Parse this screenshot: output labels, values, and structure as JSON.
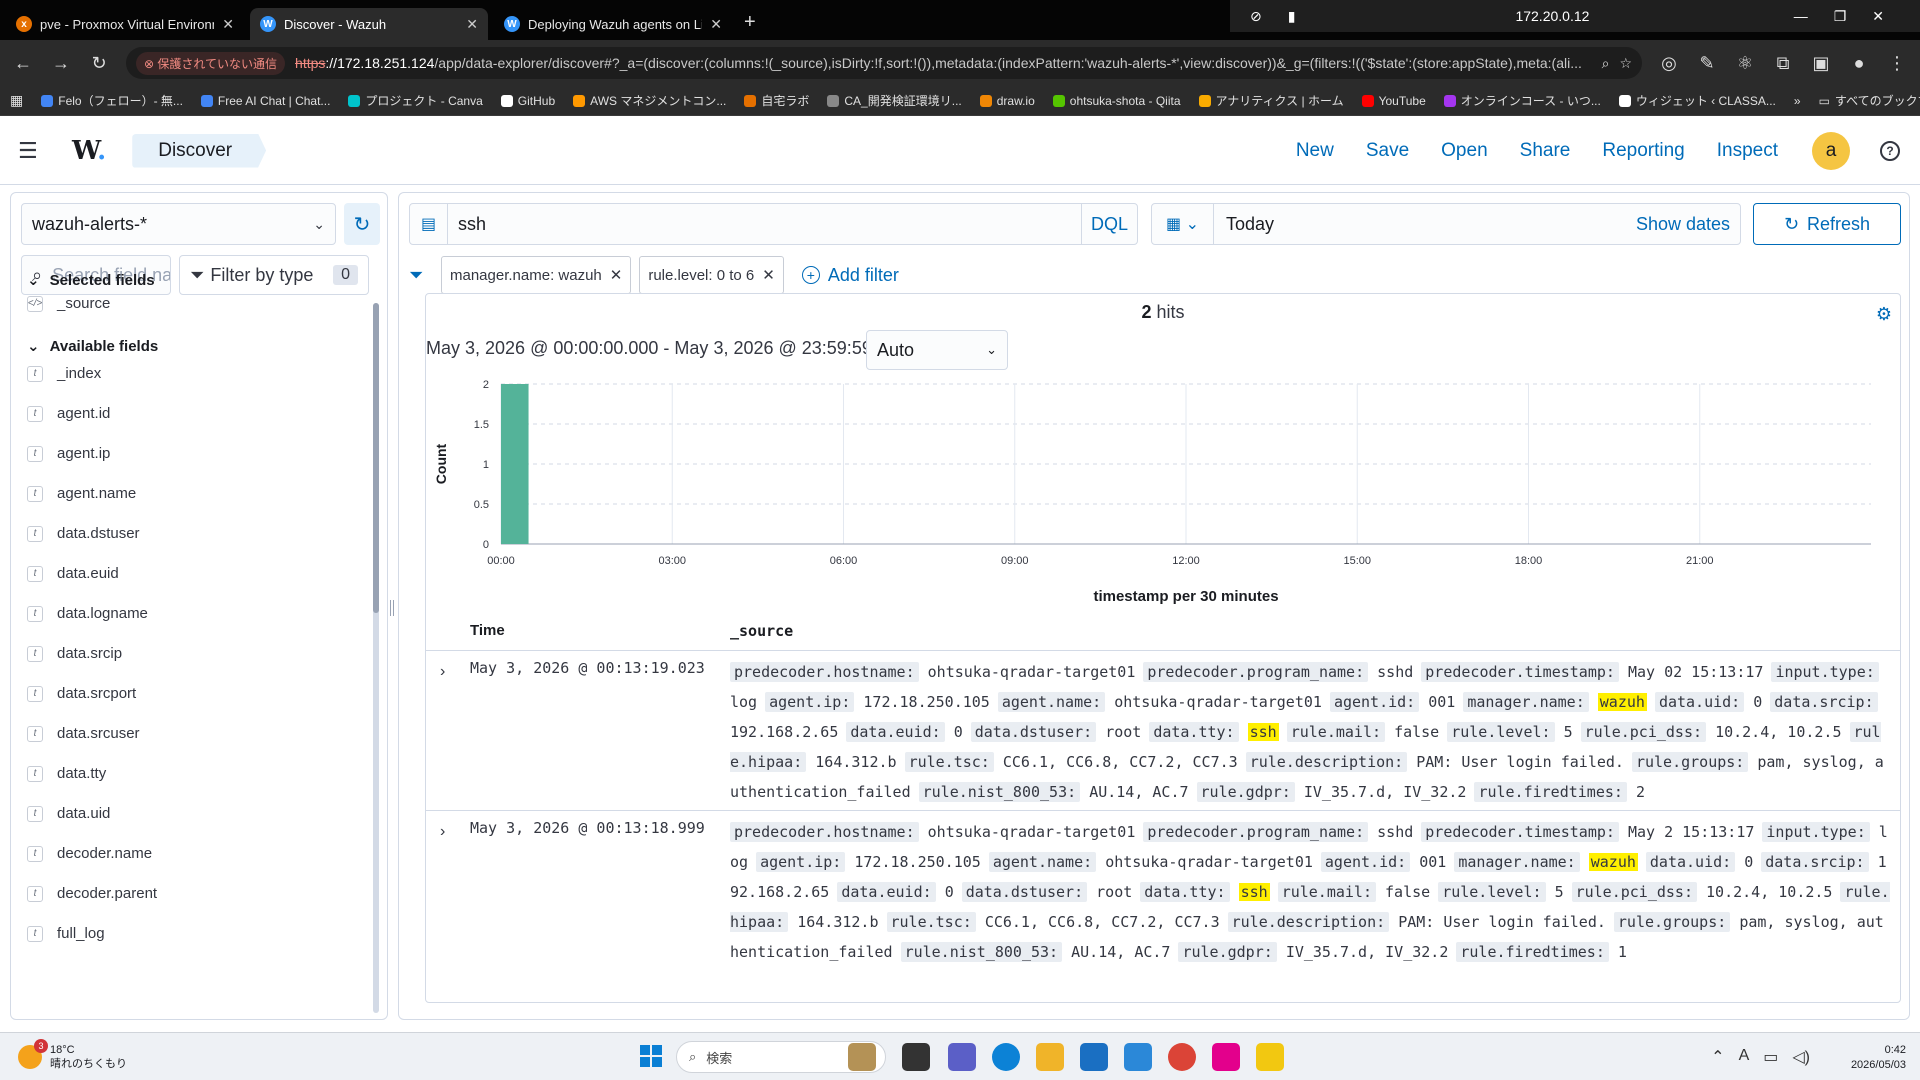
{
  "browser": {
    "tabs": [
      {
        "title": "pve - Proxmox Virtual Environment",
        "favicon_color": "#e57000",
        "favicon": "x",
        "active": false
      },
      {
        "title": "Discover - Wazuh",
        "favicon_color": "#3595f9",
        "favicon": "W",
        "active": true
      },
      {
        "title": "Deploying Wazuh agents on Linux",
        "favicon_color": "#3595f9",
        "favicon": "W",
        "active": false
      }
    ],
    "new_tab": "+",
    "system_ip": "172.20.0.12",
    "insecure_label": "保護されていない通信",
    "url_scheme": "https",
    "url_host": "://172.18.251.124",
    "url_path": "/app/data-explorer/discover#?_a=(discover:(columns:!(_source),isDirty:!f,sort:!()),metadata:(indexPattern:'wazuh-alerts-*',view:discover))&_g=(filters:!(('$state':(store:appState),meta:(ali...",
    "bookmarks": [
      {
        "label": "Felo（フェロー）- 無...",
        "color": "#4285f4"
      },
      {
        "label": "Free AI Chat | Chat...",
        "color": "#4285f4"
      },
      {
        "label": "プロジェクト - Canva",
        "color": "#00c4cc"
      },
      {
        "label": "GitHub",
        "color": "#ffffff"
      },
      {
        "label": "AWS マネジメントコン...",
        "color": "#ff9900"
      },
      {
        "label": "自宅ラボ",
        "color": "#e57000"
      },
      {
        "label": "CA_開発検証環境リ...",
        "color": "#888888"
      },
      {
        "label": "draw.io",
        "color": "#f08705"
      },
      {
        "label": "ohtsuka-shota - Qiita",
        "color": "#55c500"
      },
      {
        "label": "アナリティクス | ホーム",
        "color": "#f9ab00"
      },
      {
        "label": "YouTube",
        "color": "#ff0000"
      },
      {
        "label": "オンラインコース - いつ...",
        "color": "#a435f0"
      },
      {
        "label": "ウィジェット ‹ CLASSA...",
        "color": "#ffffff"
      }
    ],
    "bookmarks_more": "»",
    "all_bookmarks": "すべてのブックマーク"
  },
  "app": {
    "logo_text": "W",
    "logo_dot": ".",
    "breadcrumb": "Discover",
    "nav": [
      "New",
      "Save",
      "Open",
      "Share",
      "Reporting",
      "Inspect"
    ],
    "avatar": "a",
    "help": "?"
  },
  "sidebar": {
    "index_pattern": "wazuh-alerts-*",
    "search_placeholder": "Search field names",
    "filter_by_type": "Filter by type",
    "filter_count": "0",
    "selected_title": "Selected fields",
    "selected_fields": [
      "_source"
    ],
    "available_title": "Available fields",
    "available_fields": [
      "_index",
      "agent.id",
      "agent.ip",
      "agent.name",
      "data.dstuser",
      "data.euid",
      "data.logname",
      "data.srcip",
      "data.srcport",
      "data.srcuser",
      "data.tty",
      "data.uid",
      "decoder.name",
      "decoder.parent",
      "full_log"
    ]
  },
  "query": {
    "value": "ssh",
    "language": "DQL",
    "date_label": "Today",
    "show_dates": "Show dates",
    "refresh": "Refresh",
    "filters": [
      "manager.name: wazuh",
      "rule.level: 0 to 6"
    ],
    "add_filter": "Add filter"
  },
  "results": {
    "hits_count": "2",
    "hits_label": "hits",
    "range": "May 3, 2026 @ 00:00:00.000 - May 3, 2026 @ 23:59:59.999 per",
    "interval": "Auto",
    "col_time": "Time",
    "col_source": "_source",
    "rows": [
      {
        "time": "May 3, 2026 @ 00:13:19.023",
        "fields": [
          [
            "predecoder.hostname:",
            "ohtsuka-qradar-target01"
          ],
          [
            "predecoder.program_name:",
            "sshd"
          ],
          [
            "predecoder.timestamp:",
            "May 02 15:13:17"
          ],
          [
            "input.type:",
            "log"
          ],
          [
            "agent.ip:",
            "172.18.250.105"
          ],
          [
            "agent.name:",
            "ohtsuka-qradar-target01"
          ],
          [
            "agent.id:",
            "001"
          ],
          [
            "manager.name:",
            "wazuh"
          ],
          [
            "data.uid:",
            "0"
          ],
          [
            "data.srcip:",
            "192.168.2.65"
          ],
          [
            "data.euid:",
            "0"
          ],
          [
            "data.dstuser:",
            "root"
          ],
          [
            "data.tty:",
            "ssh"
          ],
          [
            "rule.mail:",
            "false"
          ],
          [
            "rule.level:",
            "5"
          ],
          [
            "rule.pci_dss:",
            "10.2.4, 10.2.5"
          ],
          [
            "rule.hipaa:",
            "164.312.b"
          ],
          [
            "rule.tsc:",
            "CC6.1, CC6.8, CC7.2, CC7.3"
          ],
          [
            "rule.description:",
            "PAM: User login failed."
          ],
          [
            "rule.groups:",
            "pam, syslog, authentication_failed"
          ],
          [
            "rule.nist_800_53:",
            "AU.14, AC.7"
          ],
          [
            "rule.gdpr:",
            "IV_35.7.d, IV_32.2"
          ],
          [
            "rule.firedtimes:",
            "2"
          ]
        ],
        "highlight": [
          "wazuh",
          "ssh"
        ]
      },
      {
        "time": "May 3, 2026 @ 00:13:18.999",
        "fields": [
          [
            "predecoder.hostname:",
            "ohtsuka-qradar-target01"
          ],
          [
            "predecoder.program_name:",
            "sshd"
          ],
          [
            "predecoder.timestamp:",
            "May 2 15:13:17"
          ],
          [
            "input.type:",
            "log"
          ],
          [
            "agent.ip:",
            "172.18.250.105"
          ],
          [
            "agent.name:",
            "ohtsuka-qradar-target01"
          ],
          [
            "agent.id:",
            "001"
          ],
          [
            "manager.name:",
            "wazuh"
          ],
          [
            "data.uid:",
            "0"
          ],
          [
            "data.srcip:",
            "192.168.2.65"
          ],
          [
            "data.euid:",
            "0"
          ],
          [
            "data.dstuser:",
            "root"
          ],
          [
            "data.tty:",
            "ssh"
          ],
          [
            "rule.mail:",
            "false"
          ],
          [
            "rule.level:",
            "5"
          ],
          [
            "rule.pci_dss:",
            "10.2.4, 10.2.5"
          ],
          [
            "rule.hipaa:",
            "164.312.b"
          ],
          [
            "rule.tsc:",
            "CC6.1, CC6.8, CC7.2, CC7.3"
          ],
          [
            "rule.description:",
            "PAM: User login failed."
          ],
          [
            "rule.groups:",
            "pam, syslog, authentication_failed"
          ],
          [
            "rule.nist_800_53:",
            "AU.14, AC.7"
          ],
          [
            "rule.gdpr:",
            "IV_35.7.d, IV_32.2"
          ],
          [
            "rule.firedtimes:",
            "1"
          ]
        ],
        "highlight": [
          "wazuh",
          "ssh"
        ]
      }
    ]
  },
  "histogram": {
    "ylabel": "Count",
    "xlabel": "timestamp per 30 minutes",
    "y_ticks": [
      "0",
      "0.5",
      "1",
      "1.5",
      "2"
    ],
    "x_ticks": [
      "00:00",
      "03:00",
      "06:00",
      "09:00",
      "12:00",
      "15:00",
      "18:00",
      "21:00"
    ],
    "bar_color": "#54b399"
  },
  "chart_data": {
    "type": "bar",
    "title": "",
    "xlabel": "timestamp per 30 minutes",
    "ylabel": "Count",
    "x": [
      "00:00"
    ],
    "values": [
      2
    ],
    "xlim": [
      "00:00",
      "24:00"
    ],
    "ylim": [
      0,
      2
    ],
    "grid": true
  },
  "taskbar": {
    "temp": "18°C",
    "weather": "晴れのちくもり",
    "weather_badge": "3",
    "search_placeholder": "検索",
    "time": "0:42",
    "date": "2026/05/03"
  }
}
